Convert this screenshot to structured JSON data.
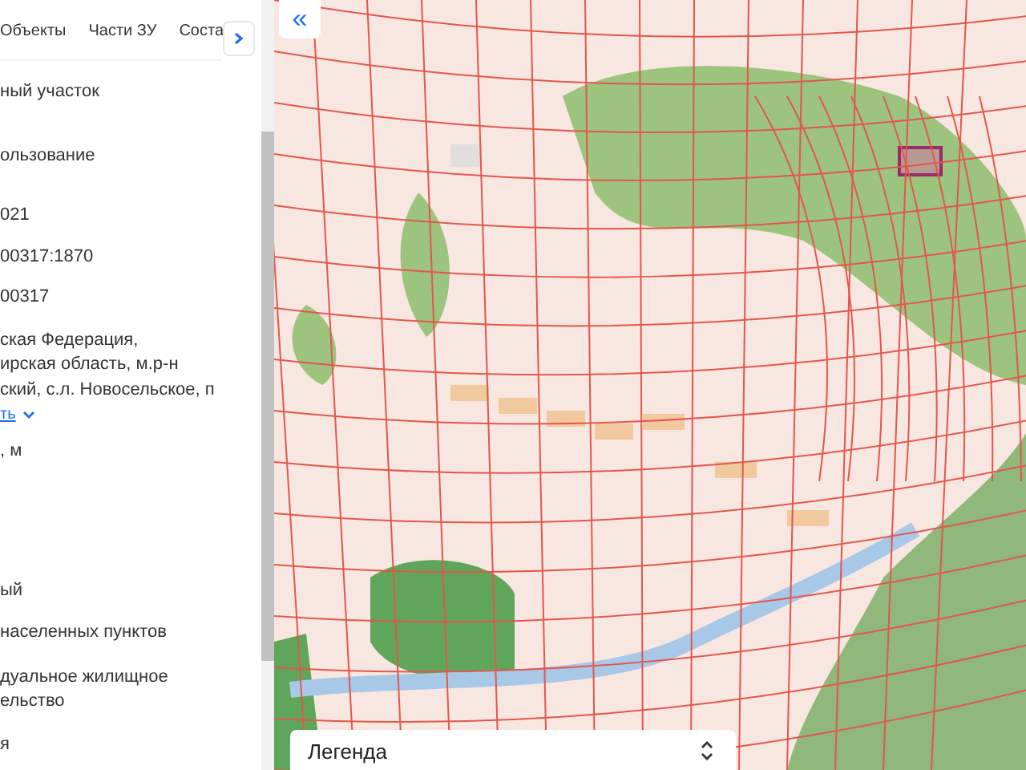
{
  "tabs": [
    {
      "label": "Объекты",
      "selected": false
    },
    {
      "label": "Части ЗУ",
      "selected": false
    },
    {
      "label": "Соста",
      "selected": false
    }
  ],
  "details": [
    {
      "kind": "text",
      "text": "ный участок"
    },
    {
      "kind": "text",
      "text": "ользование"
    },
    {
      "kind": "text",
      "text": "021"
    },
    {
      "kind": "text",
      "text": "00317:1870"
    },
    {
      "kind": "text",
      "text": "00317"
    },
    {
      "kind": "text",
      "text": "ская Федерация,\nирская область, м.р-н\nский, с.л. Новосельское, п"
    },
    {
      "kind": "link",
      "text": "ть"
    },
    {
      "kind": "text",
      "text": ", м"
    },
    {
      "kind": "text",
      "text": "ый"
    },
    {
      "kind": "text",
      "text": "населенных пунктов"
    },
    {
      "kind": "text",
      "text": "дуальное жилищное\nельство"
    },
    {
      "kind": "text",
      "text": "я"
    }
  ],
  "map": {
    "collapse_button": "«",
    "legend": {
      "title": "Легенда",
      "expanded": false
    }
  }
}
